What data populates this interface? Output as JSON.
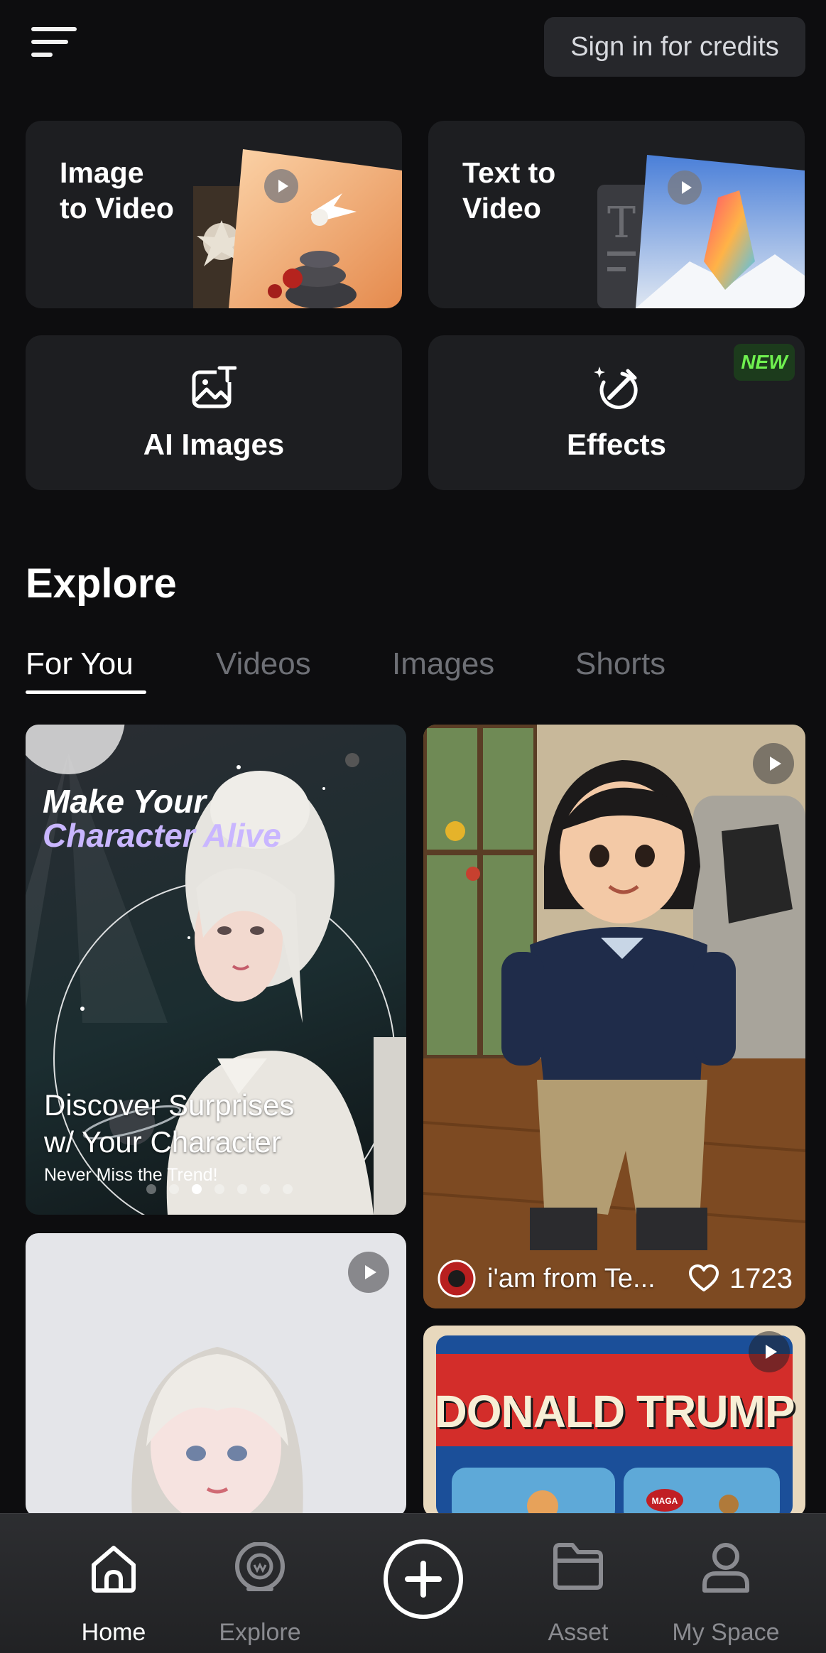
{
  "header": {
    "signin_label": "Sign in for credits"
  },
  "tools": {
    "image_to_video": "Image\nto Video",
    "text_to_video": "Text to\nVideo",
    "ai_images": "AI Images",
    "effects": "Effects",
    "effects_badge": "NEW"
  },
  "explore": {
    "title": "Explore",
    "tabs": [
      "For You",
      "Videos",
      "Images",
      "Shorts"
    ],
    "active_tab": "For You"
  },
  "feed": {
    "banner": {
      "headline_line1": "Make Your",
      "headline_line2": "Character Alive",
      "caption_line1": "Discover Surprises",
      "caption_line2": "w/ Your Character",
      "subcaption": "Never Miss the Trend!",
      "carousel_count": 7,
      "carousel_active_index": 2
    },
    "post": {
      "author": "i'am from Te...",
      "likes": "1723"
    },
    "poster_title": "DONALD TRUMP",
    "poster_cap": "MAGA"
  },
  "nav": {
    "items": [
      "Home",
      "Explore",
      "Asset",
      "My Space"
    ],
    "active": "Home"
  },
  "colors": {
    "background": "#0d0d0f",
    "card": "#1d1e21",
    "new_badge_text": "#6ff04f",
    "banner_accent": "#c9b6ff"
  }
}
